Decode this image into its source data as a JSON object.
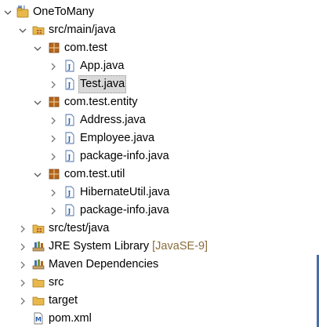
{
  "tree": {
    "root": {
      "label": "OneToMany",
      "icon": "maven-project-icon"
    },
    "src_main_java": {
      "label": "src/main/java",
      "icon": "source-folder-icon"
    },
    "pkg_com_test": {
      "label": "com.test",
      "icon": "package-icon"
    },
    "app_java": {
      "label": "App.java",
      "icon": "java-file-icon"
    },
    "test_java": {
      "label": "Test.java",
      "icon": "java-file-icon",
      "selected": true
    },
    "pkg_com_test_entity": {
      "label": "com.test.entity",
      "icon": "package-icon"
    },
    "address_java": {
      "label": "Address.java",
      "icon": "java-file-icon"
    },
    "employee_java": {
      "label": "Employee.java",
      "icon": "java-file-icon"
    },
    "package_info_entity": {
      "label": "package-info.java",
      "icon": "java-file-icon"
    },
    "pkg_com_test_util": {
      "label": "com.test.util",
      "icon": "package-icon"
    },
    "hibernate_util_java": {
      "label": "HibernateUtil.java",
      "icon": "java-file-icon"
    },
    "package_info_util": {
      "label": "package-info.java",
      "icon": "java-file-icon"
    },
    "src_test_java": {
      "label": "src/test/java",
      "icon": "source-folder-icon"
    },
    "jre_library": {
      "label": "JRE System Library",
      "suffix": "[JavaSE-9]",
      "icon": "library-icon"
    },
    "maven_dependencies": {
      "label": "Maven Dependencies",
      "icon": "library-icon"
    },
    "src": {
      "label": "src",
      "icon": "folder-icon"
    },
    "target": {
      "label": "target",
      "icon": "folder-icon"
    },
    "pom_xml": {
      "label": "pom.xml",
      "icon": "maven-file-icon"
    }
  },
  "colors": {
    "selection_bg": "#d9d9d9",
    "suffix_text": "#8a6d3b",
    "folder": "#e8b84a",
    "package": "#b5651d",
    "java_icon": "#2b5fa8"
  }
}
